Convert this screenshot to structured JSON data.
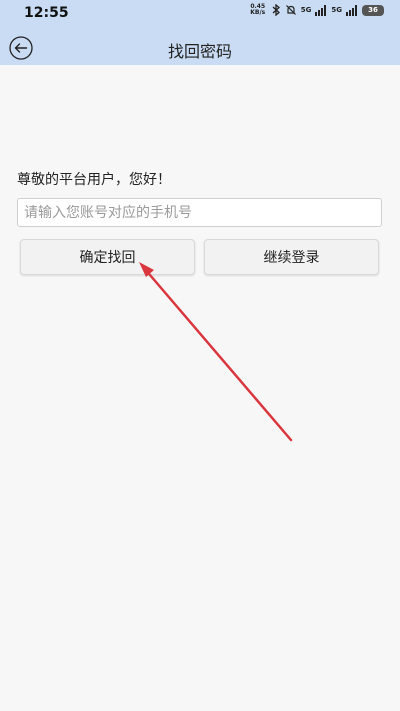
{
  "status_bar": {
    "time": "12:55",
    "net_speed_value": "0.45",
    "net_speed_unit": "KB/s",
    "network_1": "5G",
    "network_2": "5G",
    "battery": "36"
  },
  "header": {
    "title": "找回密码"
  },
  "form": {
    "greeting": "尊敬的平台用户，您好！",
    "phone_placeholder": "请输入您账号对应的手机号",
    "confirm_button": "确定找回",
    "continue_login_button": "继续登录"
  },
  "colors": {
    "header_bg": "#c9dcf3",
    "page_bg": "#f7f7f7",
    "annotation_arrow": "#d9363e"
  }
}
